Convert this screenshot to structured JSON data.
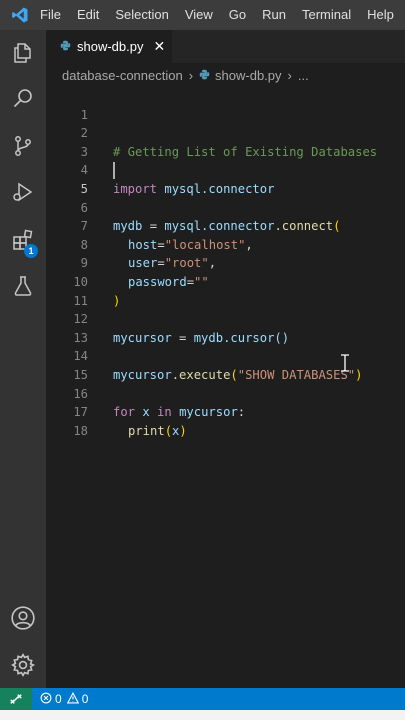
{
  "menu": [
    "File",
    "Edit",
    "Selection",
    "View",
    "Go",
    "Run",
    "Terminal",
    "Help"
  ],
  "tab": {
    "label": "show-db.py",
    "close": "✕"
  },
  "breadcrumb": {
    "folder": "database-connection",
    "file": "show-db.py",
    "more": "..."
  },
  "editor": {
    "line_numbers": [
      "1",
      "2",
      "3",
      "4",
      "5",
      "6",
      "7",
      "8",
      "9",
      "10",
      "11",
      "12",
      "13",
      "14",
      "15",
      "16",
      "17",
      "18"
    ],
    "code": {
      "comment": "# Getting List of Existing Databases",
      "import_kw": "import",
      "import_mod": "mysql.connector",
      "mydb": "mydb",
      "eq": " = ",
      "mysql_connector": "mysql.connector",
      "connect": ".connect",
      "open_paren": "(",
      "host_key": "host",
      "host_val": "\"localhost\"",
      "user_key": "user",
      "user_val": "\"root\"",
      "password_key": "password",
      "password_val": "\"\"",
      "close_paren": ")",
      "mycursor": "mycursor",
      "cursor_call": "mydb.cursor()",
      "execute_obj": "mycursor",
      "execute_fn": ".execute",
      "execute_arg": "\"SHOW DATABASES\"",
      "for_kw": "for",
      "x": "x",
      "in_kw": "in",
      "iter": "mycursor",
      "colon": ":",
      "print_fn": "print",
      "print_arg": "x"
    }
  },
  "status": {
    "errors": "0",
    "warnings": "0"
  },
  "colors": {
    "accent": "#007acc",
    "remote": "#16825d"
  }
}
